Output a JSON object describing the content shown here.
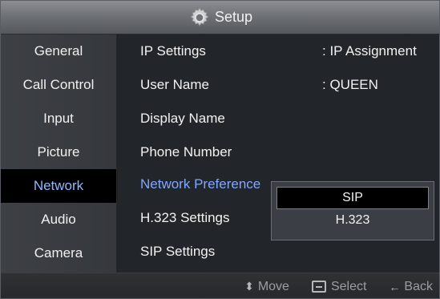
{
  "header": {
    "title": "Setup",
    "icon": "gear-icon"
  },
  "sidebar": {
    "items": [
      {
        "label": "General"
      },
      {
        "label": "Call Control"
      },
      {
        "label": "Input"
      },
      {
        "label": "Picture"
      },
      {
        "label": "Network"
      },
      {
        "label": "Audio"
      },
      {
        "label": "Camera"
      }
    ],
    "active_index": 4
  },
  "main": {
    "rows": [
      {
        "label": "IP Settings",
        "value": ": IP Assignment"
      },
      {
        "label": "User Name",
        "value": ": QUEEN"
      },
      {
        "label": "Display Name",
        "value": ""
      },
      {
        "label": "Phone Number",
        "value": ""
      },
      {
        "label": "Network Preference",
        "value": ""
      },
      {
        "label": "H.323 Settings",
        "value": ""
      },
      {
        "label": "SIP Settings",
        "value": ""
      }
    ],
    "active_index": 4
  },
  "dropdown": {
    "options": [
      "SIP",
      "H.323"
    ],
    "selected": "SIP"
  },
  "footer": {
    "move_label": "Move",
    "select_label": "Select",
    "back_label": "Back"
  },
  "colors": {
    "accent_text": "#7fa8ff",
    "background": "#22252a",
    "sidebar": "#3a3d42"
  }
}
